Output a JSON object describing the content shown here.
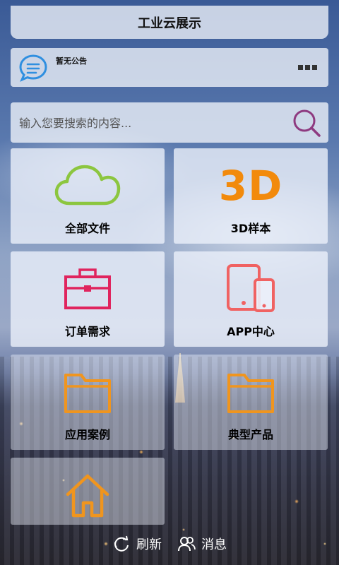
{
  "app": {
    "title": "工业云展示"
  },
  "notice": {
    "text": "暂无公告",
    "icon": "chat-bubble-icon",
    "more_icon": "more-icon"
  },
  "search": {
    "placeholder": "输入您要搜索的内容...",
    "icon": "search-icon"
  },
  "tiles": [
    {
      "label": "全部文件",
      "icon": "cloud-icon",
      "color": "#8cc63f"
    },
    {
      "label": "3D样本",
      "icon_text": "3D",
      "color": "#f28a0c"
    },
    {
      "label": "订单需求",
      "icon": "toolbox-icon",
      "color": "#e0245e"
    },
    {
      "label": "APP中心",
      "icon": "devices-icon",
      "color": "#f06262"
    },
    {
      "label": "应用案例",
      "icon": "folder-icon",
      "color": "#f0951e"
    },
    {
      "label": "典型产品",
      "icon": "folder-icon",
      "color": "#f0951e"
    },
    {
      "label": "",
      "icon": "home-icon",
      "color": "#f0951e"
    }
  ],
  "bottom_bar": {
    "refresh_label": "刷新",
    "messages_label": "消息"
  }
}
